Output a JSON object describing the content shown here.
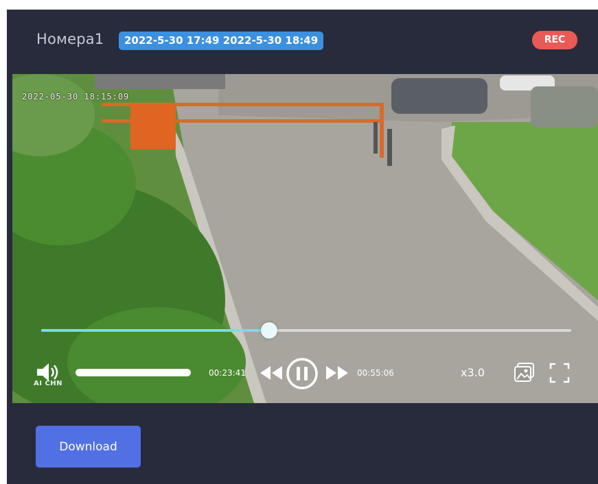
{
  "header": {
    "title": "Номера1",
    "time_range": "2022-5-30 17:49 2022-5-30 18:49",
    "rec_label": "REC"
  },
  "video": {
    "osd_timestamp": "2022-05-30 18:15:09",
    "progress_fraction": 0.43,
    "current_time": "00:23:41",
    "total_time": "00:55:06",
    "speed": "x3.0",
    "volume_label": "AI CHN",
    "volume_fraction": 1.0
  },
  "actions": {
    "download_label": "Download"
  },
  "colors": {
    "panel_bg": "#272b3b",
    "range_badge": "#3c90e0",
    "rec_badge": "#ea5a55",
    "progress": "#7fd8e8",
    "download_button": "#5170e4"
  },
  "icons": {
    "volume": "volume-icon",
    "rewind": "rewind-icon",
    "pause": "pause-icon",
    "forward": "fast-forward-icon",
    "snapshot": "snapshot-icon",
    "fullscreen": "fullscreen-icon"
  }
}
